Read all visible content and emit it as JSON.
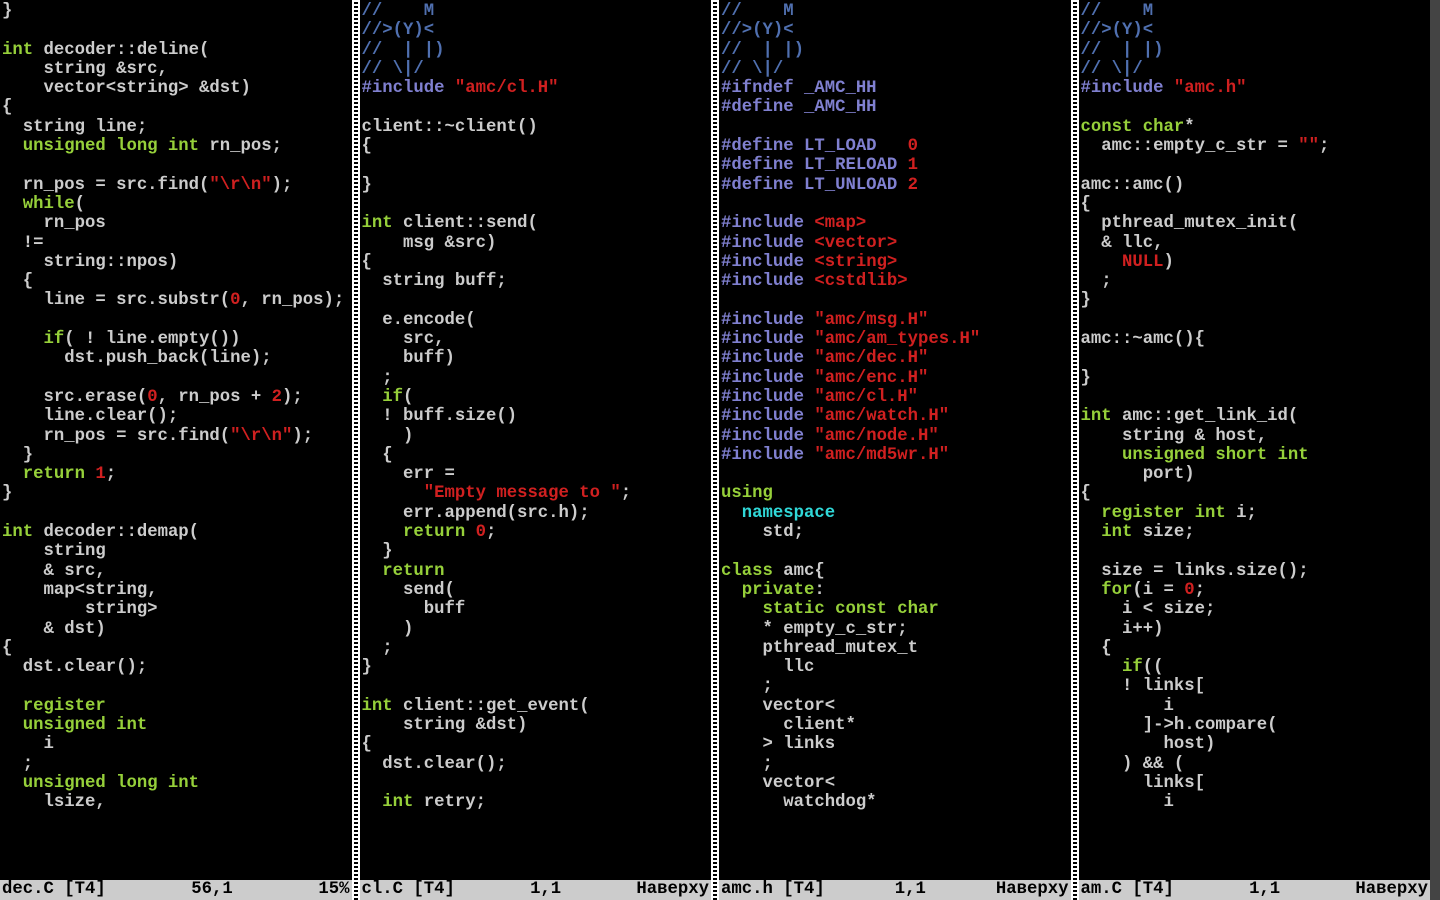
{
  "panes": [
    {
      "status": {
        "file": "dec.C [T4]",
        "pos": "56,1",
        "pct": "15%"
      },
      "lines": [
        [
          [
            "code",
            "}"
          ]
        ],
        [],
        [
          [
            "type",
            "int"
          ],
          [
            "code",
            " decoder::deline("
          ]
        ],
        [
          [
            "code",
            "    string &src,"
          ]
        ],
        [
          [
            "code",
            "    vector<string> &dst)"
          ]
        ],
        [
          [
            "code",
            "{"
          ]
        ],
        [
          [
            "code",
            "  string line;"
          ]
        ],
        [
          [
            "code",
            "  "
          ],
          [
            "type",
            "unsigned long int"
          ],
          [
            "code",
            " rn_pos;"
          ]
        ],
        [],
        [
          [
            "code",
            "  rn_pos = src.find("
          ],
          [
            "str",
            "\"\\r\\n\""
          ],
          [
            "code",
            ");"
          ]
        ],
        [
          [
            "code",
            "  "
          ],
          [
            "kw",
            "while"
          ],
          [
            "code",
            "("
          ]
        ],
        [
          [
            "code",
            "    rn_pos"
          ]
        ],
        [
          [
            "code",
            "  !="
          ]
        ],
        [
          [
            "code",
            "    string::npos)"
          ]
        ],
        [
          [
            "code",
            "  {"
          ]
        ],
        [
          [
            "code",
            "    line = src.substr("
          ],
          [
            "num",
            "0"
          ],
          [
            "code",
            ", rn_pos);"
          ]
        ],
        [],
        [
          [
            "code",
            "    "
          ],
          [
            "kw",
            "if"
          ],
          [
            "code",
            "( ! line.empty())"
          ]
        ],
        [
          [
            "code",
            "      dst.push_back(line);"
          ]
        ],
        [],
        [
          [
            "code",
            "    src.erase("
          ],
          [
            "num",
            "0"
          ],
          [
            "code",
            ", rn_pos + "
          ],
          [
            "num",
            "2"
          ],
          [
            "code",
            ");"
          ]
        ],
        [
          [
            "code",
            "    line.clear();"
          ]
        ],
        [
          [
            "code",
            "    rn_pos = src.find("
          ],
          [
            "str",
            "\"\\r\\n\""
          ],
          [
            "code",
            ");"
          ]
        ],
        [
          [
            "code",
            "  }"
          ]
        ],
        [
          [
            "code",
            "  "
          ],
          [
            "kw",
            "return"
          ],
          [
            "code",
            " "
          ],
          [
            "num",
            "1"
          ],
          [
            "code",
            ";"
          ]
        ],
        [
          [
            "code",
            "}"
          ]
        ],
        [],
        [
          [
            "type",
            "int"
          ],
          [
            "code",
            " decoder::demap("
          ]
        ],
        [
          [
            "code",
            "    string"
          ]
        ],
        [
          [
            "code",
            "    & src,"
          ]
        ],
        [
          [
            "code",
            "    map<string,"
          ]
        ],
        [
          [
            "code",
            "        string>"
          ]
        ],
        [
          [
            "code",
            "    & dst)"
          ]
        ],
        [
          [
            "code",
            "{"
          ]
        ],
        [
          [
            "code",
            "  dst.clear();"
          ]
        ],
        [],
        [
          [
            "code",
            "  "
          ],
          [
            "kw",
            "register"
          ]
        ],
        [
          [
            "code",
            "  "
          ],
          [
            "type",
            "unsigned int"
          ]
        ],
        [
          [
            "code",
            "    i"
          ]
        ],
        [
          [
            "code",
            "  ;"
          ]
        ],
        [
          [
            "code",
            "  "
          ],
          [
            "type",
            "unsigned long int"
          ]
        ],
        [
          [
            "code",
            "    lsize,"
          ]
        ]
      ]
    },
    {
      "status": {
        "file": "cl.C [T4]",
        "pos": "1,1",
        "pct": "Наверху"
      },
      "lines": [
        [
          [
            "cmt",
            "//    M"
          ]
        ],
        [
          [
            "cmt",
            "//>(Y)<"
          ]
        ],
        [
          [
            "cmt",
            "//  | |)"
          ]
        ],
        [
          [
            "cmt",
            "// \\|/"
          ]
        ],
        [
          [
            "pre",
            "#include"
          ],
          [
            "code",
            " "
          ],
          [
            "str",
            "\"amc/cl.H\""
          ]
        ],
        [],
        [
          [
            "code",
            "client::~client()"
          ]
        ],
        [
          [
            "code",
            "{"
          ]
        ],
        [],
        [
          [
            "code",
            "}"
          ]
        ],
        [],
        [
          [
            "type",
            "int"
          ],
          [
            "code",
            " client::send("
          ]
        ],
        [
          [
            "code",
            "    msg &src)"
          ]
        ],
        [
          [
            "code",
            "{"
          ]
        ],
        [
          [
            "code",
            "  string buff;"
          ]
        ],
        [],
        [
          [
            "code",
            "  e.encode("
          ]
        ],
        [
          [
            "code",
            "    src,"
          ]
        ],
        [
          [
            "code",
            "    buff)"
          ]
        ],
        [
          [
            "code",
            "  ;"
          ]
        ],
        [
          [
            "code",
            "  "
          ],
          [
            "kw",
            "if"
          ],
          [
            "code",
            "("
          ]
        ],
        [
          [
            "code",
            "  ! buff.size()"
          ]
        ],
        [
          [
            "code",
            "    )"
          ]
        ],
        [
          [
            "code",
            "  {"
          ]
        ],
        [
          [
            "code",
            "    err ="
          ]
        ],
        [
          [
            "code",
            "      "
          ],
          [
            "str",
            "\"Empty message to \""
          ],
          [
            "code",
            ";"
          ]
        ],
        [
          [
            "code",
            "    err.append(src.h);"
          ]
        ],
        [
          [
            "code",
            "    "
          ],
          [
            "kw",
            "return"
          ],
          [
            "code",
            " "
          ],
          [
            "num",
            "0"
          ],
          [
            "code",
            ";"
          ]
        ],
        [
          [
            "code",
            "  }"
          ]
        ],
        [
          [
            "code",
            "  "
          ],
          [
            "kw",
            "return"
          ]
        ],
        [
          [
            "code",
            "    send("
          ]
        ],
        [
          [
            "code",
            "      buff"
          ]
        ],
        [
          [
            "code",
            "    )"
          ]
        ],
        [
          [
            "code",
            "  ;"
          ]
        ],
        [
          [
            "code",
            "}"
          ]
        ],
        [],
        [
          [
            "type",
            "int"
          ],
          [
            "code",
            " client::get_event("
          ]
        ],
        [
          [
            "code",
            "    string &dst)"
          ]
        ],
        [
          [
            "code",
            "{"
          ]
        ],
        [
          [
            "code",
            "  dst.clear();"
          ]
        ],
        [],
        [
          [
            "code",
            "  "
          ],
          [
            "type",
            "int"
          ],
          [
            "code",
            " retry;"
          ]
        ]
      ]
    },
    {
      "status": {
        "file": "amc.h [T4]",
        "pos": "1,1",
        "pct": "Наверху"
      },
      "lines": [
        [
          [
            "cmt",
            "//    M"
          ]
        ],
        [
          [
            "cmt",
            "//>(Y)<"
          ]
        ],
        [
          [
            "cmt",
            "//  | |)"
          ]
        ],
        [
          [
            "cmt",
            "// \\|/"
          ]
        ],
        [
          [
            "pre",
            "#ifndef _AMC_HH"
          ]
        ],
        [
          [
            "pre",
            "#define _AMC_HH"
          ]
        ],
        [],
        [
          [
            "pre",
            "#define LT_LOAD   "
          ],
          [
            "num",
            "0"
          ]
        ],
        [
          [
            "pre",
            "#define LT_RELOAD "
          ],
          [
            "num",
            "1"
          ]
        ],
        [
          [
            "pre",
            "#define LT_UNLOAD "
          ],
          [
            "num",
            "2"
          ]
        ],
        [],
        [
          [
            "pre",
            "#include "
          ],
          [
            "str",
            "<map>"
          ]
        ],
        [
          [
            "pre",
            "#include "
          ],
          [
            "str",
            "<vector>"
          ]
        ],
        [
          [
            "pre",
            "#include "
          ],
          [
            "str",
            "<string>"
          ]
        ],
        [
          [
            "pre",
            "#include "
          ],
          [
            "str",
            "<cstdlib>"
          ]
        ],
        [],
        [
          [
            "pre",
            "#include "
          ],
          [
            "str",
            "\"amc/msg.H\""
          ]
        ],
        [
          [
            "pre",
            "#include "
          ],
          [
            "str",
            "\"amc/am_types.H\""
          ]
        ],
        [
          [
            "pre",
            "#include "
          ],
          [
            "str",
            "\"amc/dec.H\""
          ]
        ],
        [
          [
            "pre",
            "#include "
          ],
          [
            "str",
            "\"amc/enc.H\""
          ]
        ],
        [
          [
            "pre",
            "#include "
          ],
          [
            "str",
            "\"amc/cl.H\""
          ]
        ],
        [
          [
            "pre",
            "#include "
          ],
          [
            "str",
            "\"amc/watch.H\""
          ]
        ],
        [
          [
            "pre",
            "#include "
          ],
          [
            "str",
            "\"amc/node.H\""
          ]
        ],
        [
          [
            "pre",
            "#include "
          ],
          [
            "str",
            "\"amc/md5wr.H\""
          ]
        ],
        [],
        [
          [
            "kw",
            "using"
          ]
        ],
        [
          [
            "code",
            "  "
          ],
          [
            "ident",
            "namespace"
          ]
        ],
        [
          [
            "code",
            "    std;"
          ]
        ],
        [],
        [
          [
            "kw",
            "class"
          ],
          [
            "code",
            " amc{"
          ]
        ],
        [
          [
            "code",
            "  "
          ],
          [
            "kw",
            "private"
          ],
          [
            "code",
            ":"
          ]
        ],
        [
          [
            "code",
            "    "
          ],
          [
            "type",
            "static const char"
          ]
        ],
        [
          [
            "code",
            "    * empty_c_str;"
          ]
        ],
        [
          [
            "code",
            "    pthread_mutex_t"
          ]
        ],
        [
          [
            "code",
            "      llc"
          ]
        ],
        [
          [
            "code",
            "    ;"
          ]
        ],
        [
          [
            "code",
            "    vector<"
          ]
        ],
        [
          [
            "code",
            "      client*"
          ]
        ],
        [
          [
            "code",
            "    > links"
          ]
        ],
        [
          [
            "code",
            "    ;"
          ]
        ],
        [
          [
            "code",
            "    vector<"
          ]
        ],
        [
          [
            "code",
            "      watchdog*"
          ]
        ]
      ]
    },
    {
      "status": {
        "file": "am.C [T4]",
        "pos": "1,1",
        "pct": "Наверху"
      },
      "lines": [
        [
          [
            "cmt",
            "//    M"
          ]
        ],
        [
          [
            "cmt",
            "//>(Y)<"
          ]
        ],
        [
          [
            "cmt",
            "//  | |)"
          ]
        ],
        [
          [
            "cmt",
            "// \\|/"
          ]
        ],
        [
          [
            "pre",
            "#include"
          ],
          [
            "code",
            " "
          ],
          [
            "str",
            "\"amc.h\""
          ]
        ],
        [],
        [
          [
            "type",
            "const char"
          ],
          [
            "code",
            "*"
          ]
        ],
        [
          [
            "code",
            "  amc::empty_c_str = "
          ],
          [
            "str",
            "\"\""
          ],
          [
            "code",
            ";"
          ]
        ],
        [],
        [
          [
            "code",
            "amc::amc()"
          ]
        ],
        [
          [
            "code",
            "{"
          ]
        ],
        [
          [
            "code",
            "  pthread_mutex_init("
          ]
        ],
        [
          [
            "code",
            "  & llc,"
          ]
        ],
        [
          [
            "code",
            "    "
          ],
          [
            "num",
            "NULL"
          ],
          [
            "code",
            ")"
          ]
        ],
        [
          [
            "code",
            "  ;"
          ]
        ],
        [
          [
            "code",
            "}"
          ]
        ],
        [],
        [
          [
            "code",
            "amc::~amc(){"
          ]
        ],
        [],
        [
          [
            "code",
            "}"
          ]
        ],
        [],
        [
          [
            "type",
            "int"
          ],
          [
            "code",
            " amc::get_link_id("
          ]
        ],
        [
          [
            "code",
            "    string & host,"
          ]
        ],
        [
          [
            "code",
            "    "
          ],
          [
            "type",
            "unsigned short int"
          ]
        ],
        [
          [
            "code",
            "      port)"
          ]
        ],
        [
          [
            "code",
            "{"
          ]
        ],
        [
          [
            "code",
            "  "
          ],
          [
            "kw",
            "register"
          ],
          [
            "code",
            " "
          ],
          [
            "type",
            "int"
          ],
          [
            "code",
            " i;"
          ]
        ],
        [
          [
            "code",
            "  "
          ],
          [
            "type",
            "int"
          ],
          [
            "code",
            " size;"
          ]
        ],
        [],
        [
          [
            "code",
            "  size = links.size();"
          ]
        ],
        [
          [
            "code",
            "  "
          ],
          [
            "kw",
            "for"
          ],
          [
            "code",
            "(i = "
          ],
          [
            "num",
            "0"
          ],
          [
            "code",
            ";"
          ]
        ],
        [
          [
            "code",
            "    i < size;"
          ]
        ],
        [
          [
            "code",
            "    i++)"
          ]
        ],
        [
          [
            "code",
            "  {"
          ]
        ],
        [
          [
            "code",
            "    "
          ],
          [
            "kw",
            "if"
          ],
          [
            "code",
            "(("
          ]
        ],
        [
          [
            "code",
            "    ! links["
          ]
        ],
        [
          [
            "code",
            "        i"
          ]
        ],
        [
          [
            "code",
            "      ]->h.compare("
          ]
        ],
        [
          [
            "code",
            "        host)"
          ]
        ],
        [
          [
            "code",
            "    ) && ("
          ]
        ],
        [
          [
            "code",
            "      links["
          ]
        ],
        [
          [
            "code",
            "        i"
          ]
        ]
      ]
    }
  ]
}
